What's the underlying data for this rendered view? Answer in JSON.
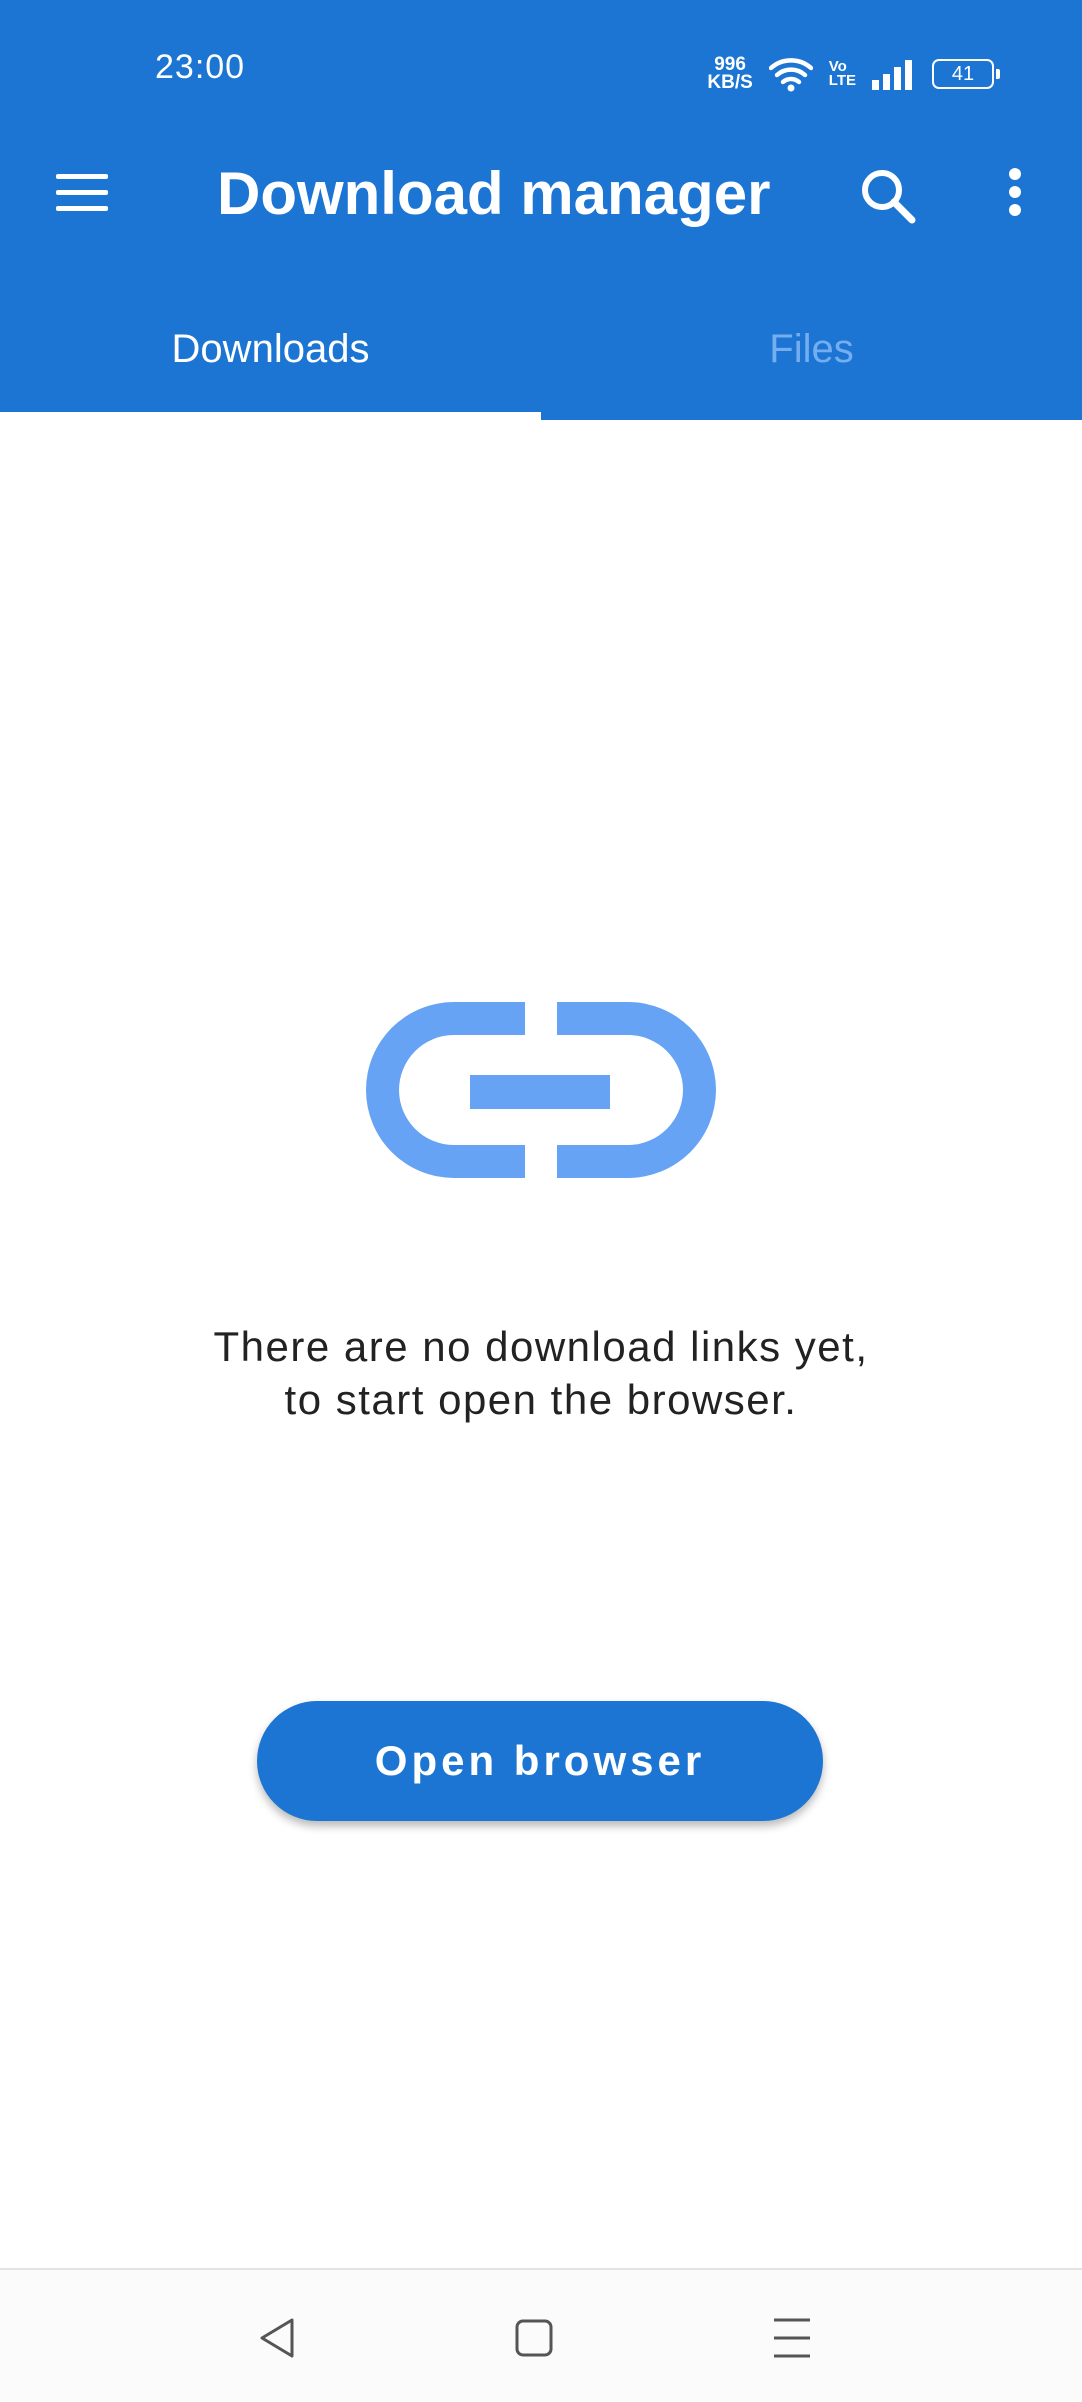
{
  "status_bar": {
    "time": "23:00",
    "net_speed_value": "996",
    "net_speed_unit": "KB/S",
    "volte_top": "Vo",
    "volte_bottom": "LTE",
    "battery_level": "41",
    "icons": [
      "wifi-icon",
      "signal-icon",
      "battery-icon"
    ]
  },
  "app_bar": {
    "title": "Download manager",
    "icons": [
      "menu-icon",
      "search-icon",
      "more-vert-icon"
    ]
  },
  "tabs": [
    {
      "label": "Downloads",
      "selected": true
    },
    {
      "label": "Files",
      "selected": false
    }
  ],
  "empty_state": {
    "icon": "link-icon",
    "message": "There are no download links yet, to start open the browser."
  },
  "primary_action": {
    "label": "Open browser"
  },
  "nav_bar": {
    "icons": [
      "back-icon",
      "home-icon",
      "recents-icon"
    ]
  },
  "colors": {
    "primary": "#1c75d3",
    "icon_accent": "#66a3f5",
    "tab_inactive_text": "#74aef0",
    "body_text": "#222222"
  }
}
